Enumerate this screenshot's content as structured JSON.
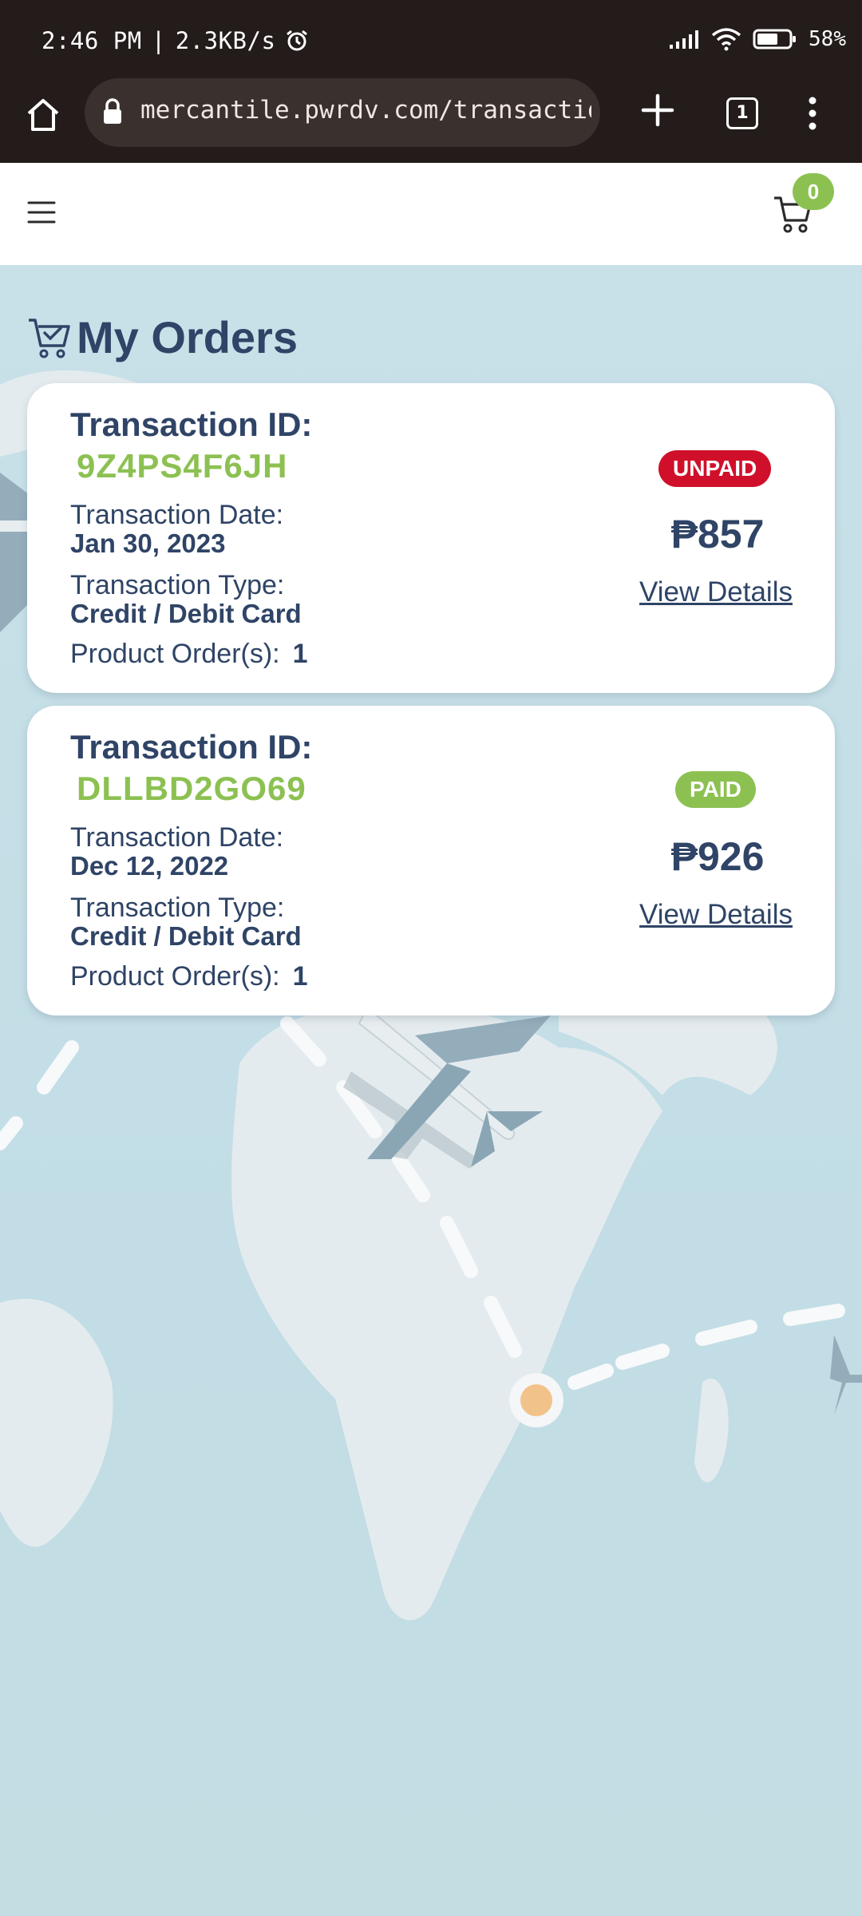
{
  "status_bar": {
    "time": "2:46 PM",
    "separator": "|",
    "speed": "2.3KB/s",
    "battery": "58%"
  },
  "browser": {
    "url": "mercantile.pwrdv.com/transactions",
    "tab_count": "1"
  },
  "header": {
    "cart_count": "0"
  },
  "page": {
    "title": "My Orders"
  },
  "orders": [
    {
      "id_label": "Transaction ID:",
      "id": "9Z4PS4F6JH",
      "date_label": "Transaction Date:",
      "date": "Jan 30, 2023",
      "type_label": "Transaction Type:",
      "type": "Credit / Debit Card",
      "product_label": "Product Order(s):",
      "product_count": "1",
      "status": "UNPAID",
      "status_color": "#d0102a",
      "price": "₱857",
      "view_details": "View Details"
    },
    {
      "id_label": "Transaction ID:",
      "id": "DLLBD2GO69",
      "date_label": "Transaction Date:",
      "date": "Dec 12, 2022",
      "type_label": "Transaction Type:",
      "type": "Credit / Debit Card",
      "product_label": "Product Order(s):",
      "product_count": "1",
      "status": "PAID",
      "status_color": "#8cc152",
      "price": "₱926",
      "view_details": "View Details"
    }
  ],
  "colors": {
    "accent_green": "#8cc152",
    "unpaid_red": "#d0102a",
    "text_navy": "#2f4466"
  }
}
